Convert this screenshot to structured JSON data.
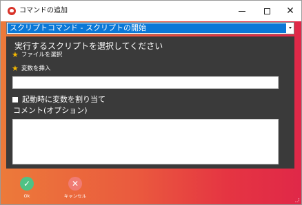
{
  "window": {
    "title": "コマンドの追加",
    "icon": "app-logo-icon",
    "controls": {
      "minimize": "minimize-icon",
      "maximize": "maximize-icon",
      "close": "close-icon"
    }
  },
  "command_select": {
    "selected": "スクリプトコマンド - スクリプトの開始",
    "arrow_icon": "chevron-down-icon"
  },
  "panel": {
    "heading": "実行するスクリプトを選択してください",
    "link_select_file": "ファイルを選択",
    "link_insert_variable": "変数を挿入",
    "link_icon": "star-icon",
    "script_path_value": "",
    "assign_variable_checkbox_label": "起動時に変数を割り当て",
    "assign_variable_checked": false,
    "comment_label": "コメント(オプション)",
    "comment_value": ""
  },
  "actions": {
    "ok_label": "Ok",
    "cancel_label": "キャンセル"
  },
  "colors": {
    "accent_selection": "#0b78d7",
    "panel_bg": "#3a3a3a",
    "gradient_start": "#ec7a3a",
    "gradient_end": "#e02848",
    "ok": "#4fc285",
    "cancel": "#f07b73",
    "star": "#f5b800"
  }
}
